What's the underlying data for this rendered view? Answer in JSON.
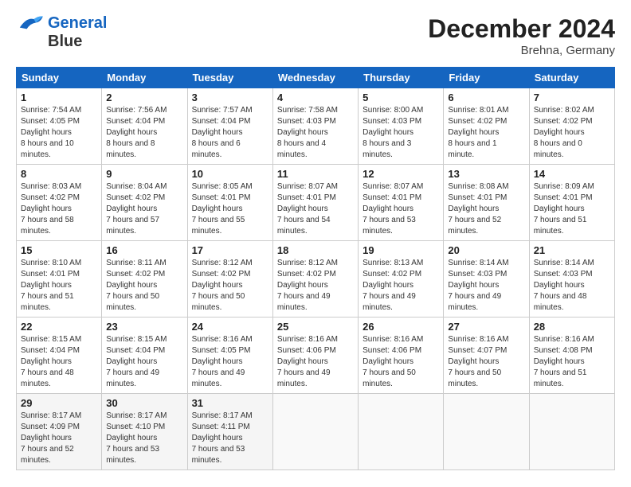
{
  "logo": {
    "line1": "General",
    "line2": "Blue"
  },
  "header": {
    "month": "December 2024",
    "location": "Brehna, Germany"
  },
  "weekdays": [
    "Sunday",
    "Monday",
    "Tuesday",
    "Wednesday",
    "Thursday",
    "Friday",
    "Saturday"
  ],
  "weeks": [
    [
      {
        "day": "1",
        "sunrise": "7:54 AM",
        "sunset": "4:05 PM",
        "daylight": "8 hours and 10 minutes."
      },
      {
        "day": "2",
        "sunrise": "7:56 AM",
        "sunset": "4:04 PM",
        "daylight": "8 hours and 8 minutes."
      },
      {
        "day": "3",
        "sunrise": "7:57 AM",
        "sunset": "4:04 PM",
        "daylight": "8 hours and 6 minutes."
      },
      {
        "day": "4",
        "sunrise": "7:58 AM",
        "sunset": "4:03 PM",
        "daylight": "8 hours and 4 minutes."
      },
      {
        "day": "5",
        "sunrise": "8:00 AM",
        "sunset": "4:03 PM",
        "daylight": "8 hours and 3 minutes."
      },
      {
        "day": "6",
        "sunrise": "8:01 AM",
        "sunset": "4:02 PM",
        "daylight": "8 hours and 1 minute."
      },
      {
        "day": "7",
        "sunrise": "8:02 AM",
        "sunset": "4:02 PM",
        "daylight": "8 hours and 0 minutes."
      }
    ],
    [
      {
        "day": "8",
        "sunrise": "8:03 AM",
        "sunset": "4:02 PM",
        "daylight": "7 hours and 58 minutes."
      },
      {
        "day": "9",
        "sunrise": "8:04 AM",
        "sunset": "4:02 PM",
        "daylight": "7 hours and 57 minutes."
      },
      {
        "day": "10",
        "sunrise": "8:05 AM",
        "sunset": "4:01 PM",
        "daylight": "7 hours and 55 minutes."
      },
      {
        "day": "11",
        "sunrise": "8:07 AM",
        "sunset": "4:01 PM",
        "daylight": "7 hours and 54 minutes."
      },
      {
        "day": "12",
        "sunrise": "8:07 AM",
        "sunset": "4:01 PM",
        "daylight": "7 hours and 53 minutes."
      },
      {
        "day": "13",
        "sunrise": "8:08 AM",
        "sunset": "4:01 PM",
        "daylight": "7 hours and 52 minutes."
      },
      {
        "day": "14",
        "sunrise": "8:09 AM",
        "sunset": "4:01 PM",
        "daylight": "7 hours and 51 minutes."
      }
    ],
    [
      {
        "day": "15",
        "sunrise": "8:10 AM",
        "sunset": "4:01 PM",
        "daylight": "7 hours and 51 minutes."
      },
      {
        "day": "16",
        "sunrise": "8:11 AM",
        "sunset": "4:02 PM",
        "daylight": "7 hours and 50 minutes."
      },
      {
        "day": "17",
        "sunrise": "8:12 AM",
        "sunset": "4:02 PM",
        "daylight": "7 hours and 50 minutes."
      },
      {
        "day": "18",
        "sunrise": "8:12 AM",
        "sunset": "4:02 PM",
        "daylight": "7 hours and 49 minutes."
      },
      {
        "day": "19",
        "sunrise": "8:13 AM",
        "sunset": "4:02 PM",
        "daylight": "7 hours and 49 minutes."
      },
      {
        "day": "20",
        "sunrise": "8:14 AM",
        "sunset": "4:03 PM",
        "daylight": "7 hours and 49 minutes."
      },
      {
        "day": "21",
        "sunrise": "8:14 AM",
        "sunset": "4:03 PM",
        "daylight": "7 hours and 48 minutes."
      }
    ],
    [
      {
        "day": "22",
        "sunrise": "8:15 AM",
        "sunset": "4:04 PM",
        "daylight": "7 hours and 48 minutes."
      },
      {
        "day": "23",
        "sunrise": "8:15 AM",
        "sunset": "4:04 PM",
        "daylight": "7 hours and 49 minutes."
      },
      {
        "day": "24",
        "sunrise": "8:16 AM",
        "sunset": "4:05 PM",
        "daylight": "7 hours and 49 minutes."
      },
      {
        "day": "25",
        "sunrise": "8:16 AM",
        "sunset": "4:06 PM",
        "daylight": "7 hours and 49 minutes."
      },
      {
        "day": "26",
        "sunrise": "8:16 AM",
        "sunset": "4:06 PM",
        "daylight": "7 hours and 50 minutes."
      },
      {
        "day": "27",
        "sunrise": "8:16 AM",
        "sunset": "4:07 PM",
        "daylight": "7 hours and 50 minutes."
      },
      {
        "day": "28",
        "sunrise": "8:16 AM",
        "sunset": "4:08 PM",
        "daylight": "7 hours and 51 minutes."
      }
    ],
    [
      {
        "day": "29",
        "sunrise": "8:17 AM",
        "sunset": "4:09 PM",
        "daylight": "7 hours and 52 minutes."
      },
      {
        "day": "30",
        "sunrise": "8:17 AM",
        "sunset": "4:10 PM",
        "daylight": "7 hours and 53 minutes."
      },
      {
        "day": "31",
        "sunrise": "8:17 AM",
        "sunset": "4:11 PM",
        "daylight": "7 hours and 53 minutes."
      },
      null,
      null,
      null,
      null
    ]
  ]
}
